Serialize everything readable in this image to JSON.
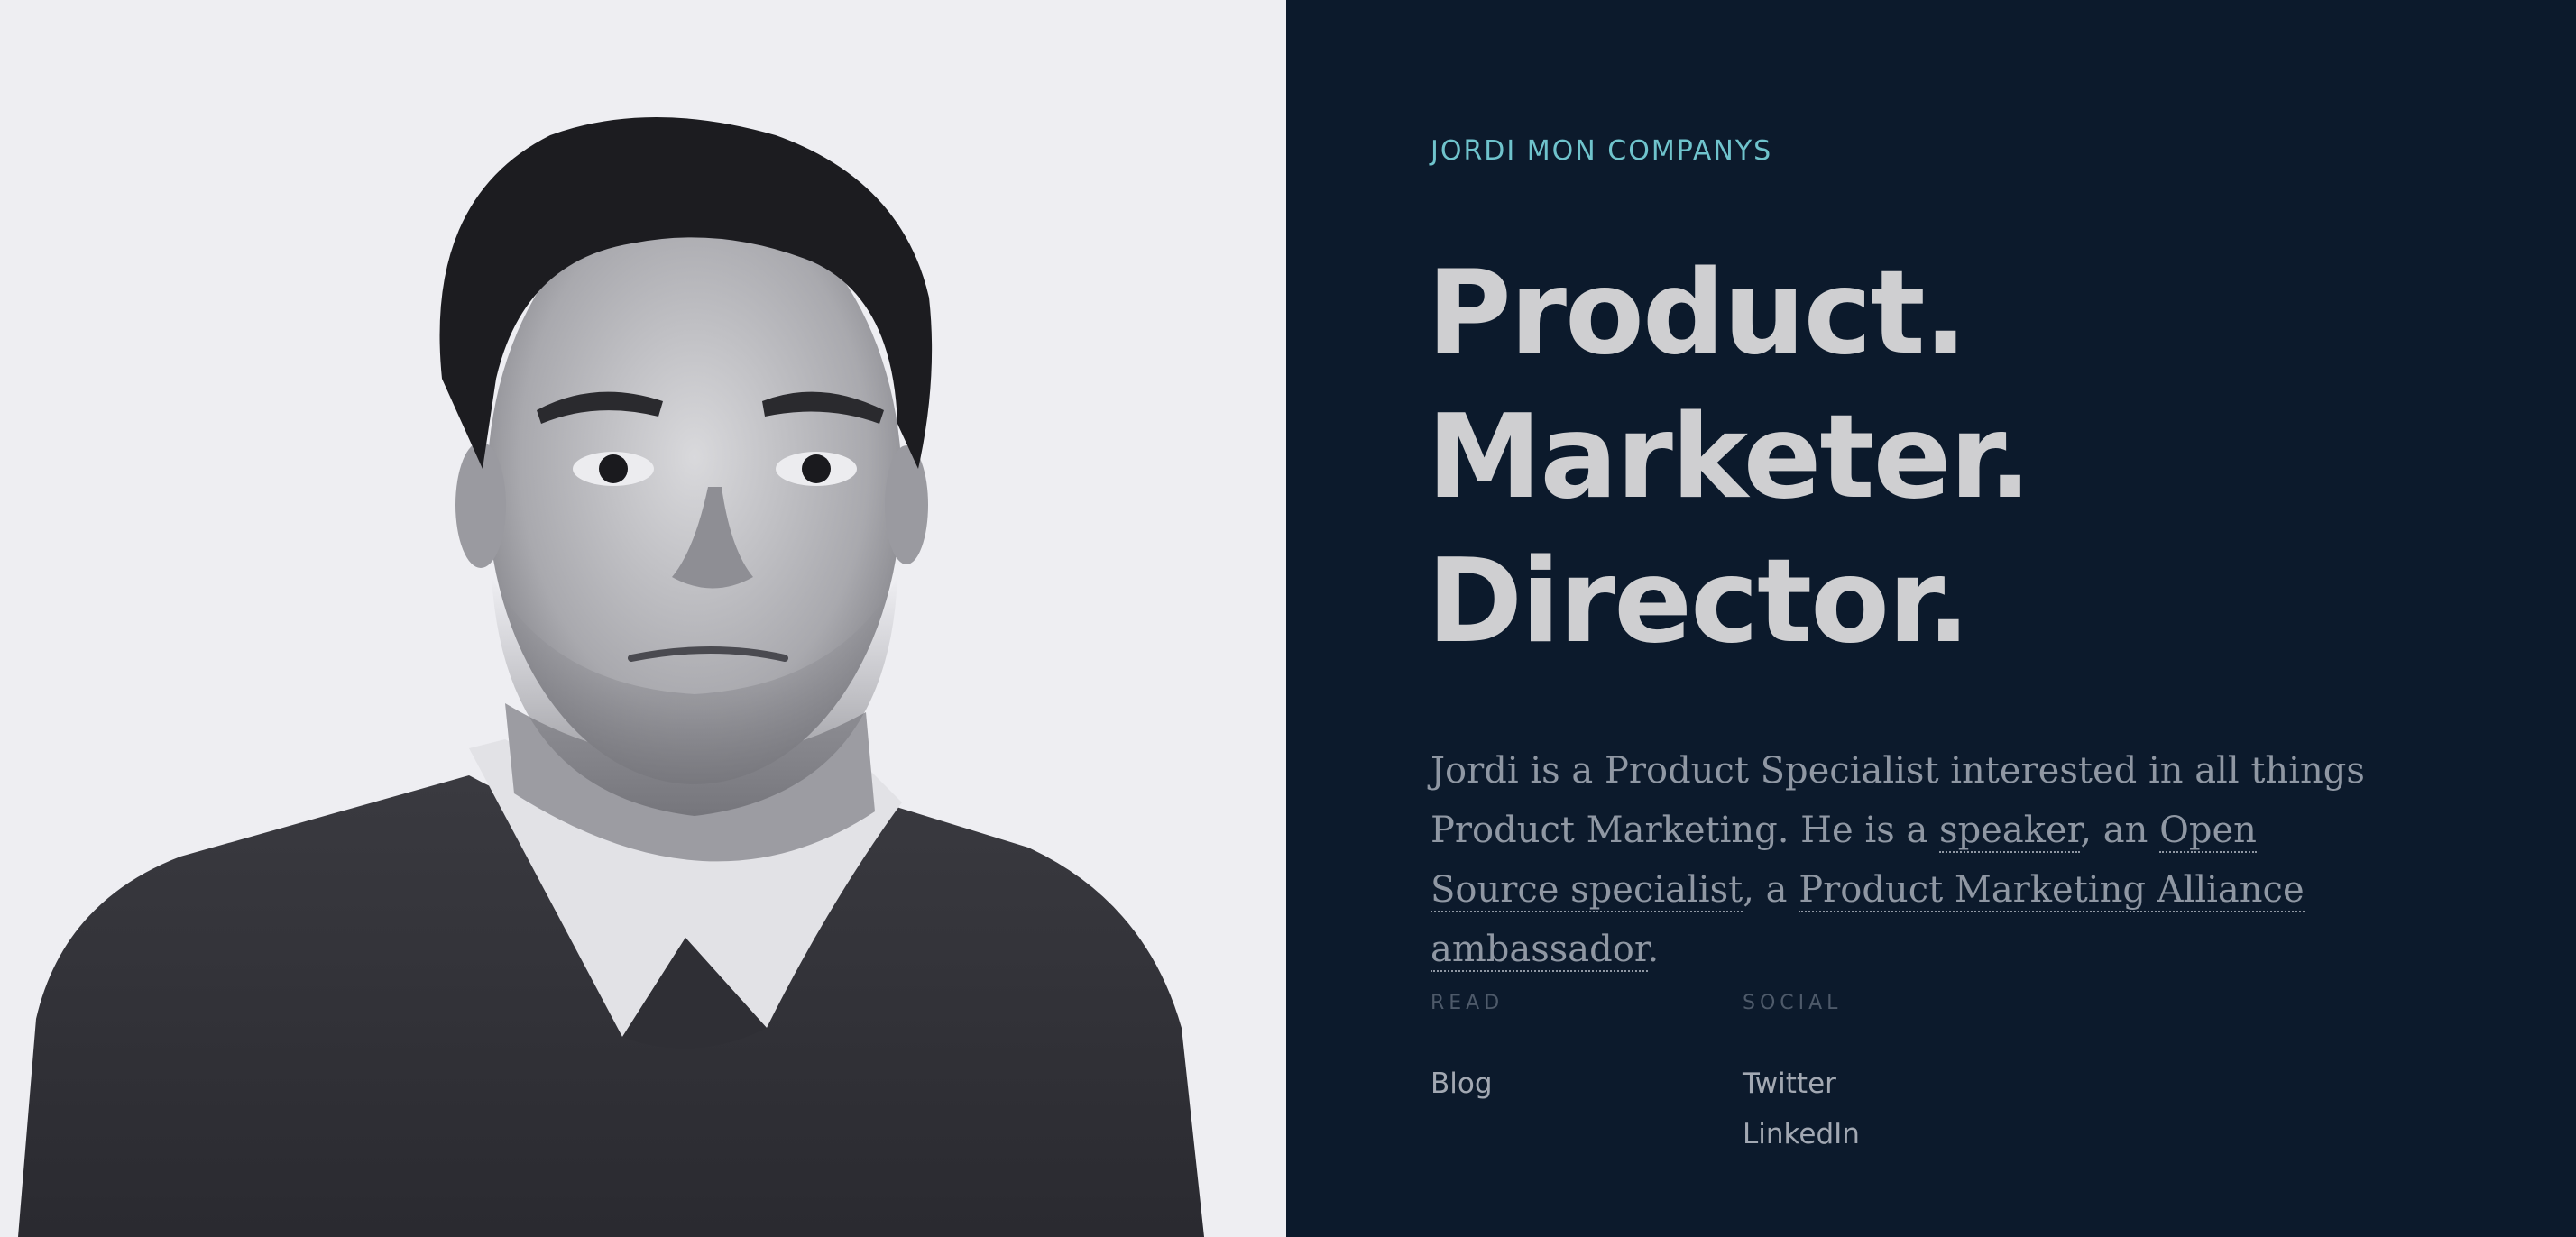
{
  "portrait": {
    "alt": "Black and white portrait of Jordi Mon Companys"
  },
  "brand": {
    "name": "JORDI MON COMPANYS"
  },
  "headline": {
    "line1": "Product.",
    "line2": "Marketer.",
    "line3": "Director."
  },
  "bio": {
    "text_1": "Jordi is a Product Specialist interested in all things Product Marketing. He is a ",
    "link_speaker": "speaker",
    "text_2": ", an ",
    "link_open_source": "Open Source specialist",
    "text_3": ", a ",
    "link_pma": "Product Marketing Alliance ambassador",
    "text_4": "."
  },
  "read": {
    "label": "READ",
    "links": [
      "Blog"
    ]
  },
  "social": {
    "label": "SOCIAL",
    "links": [
      "Twitter",
      "LinkedIn"
    ]
  },
  "colors": {
    "panel_bg": "#0c1a2c",
    "portrait_bg": "#eeeef2",
    "accent": "#6fc3cc",
    "headline": "#cfcfd1",
    "body_text": "#8f97a3"
  }
}
